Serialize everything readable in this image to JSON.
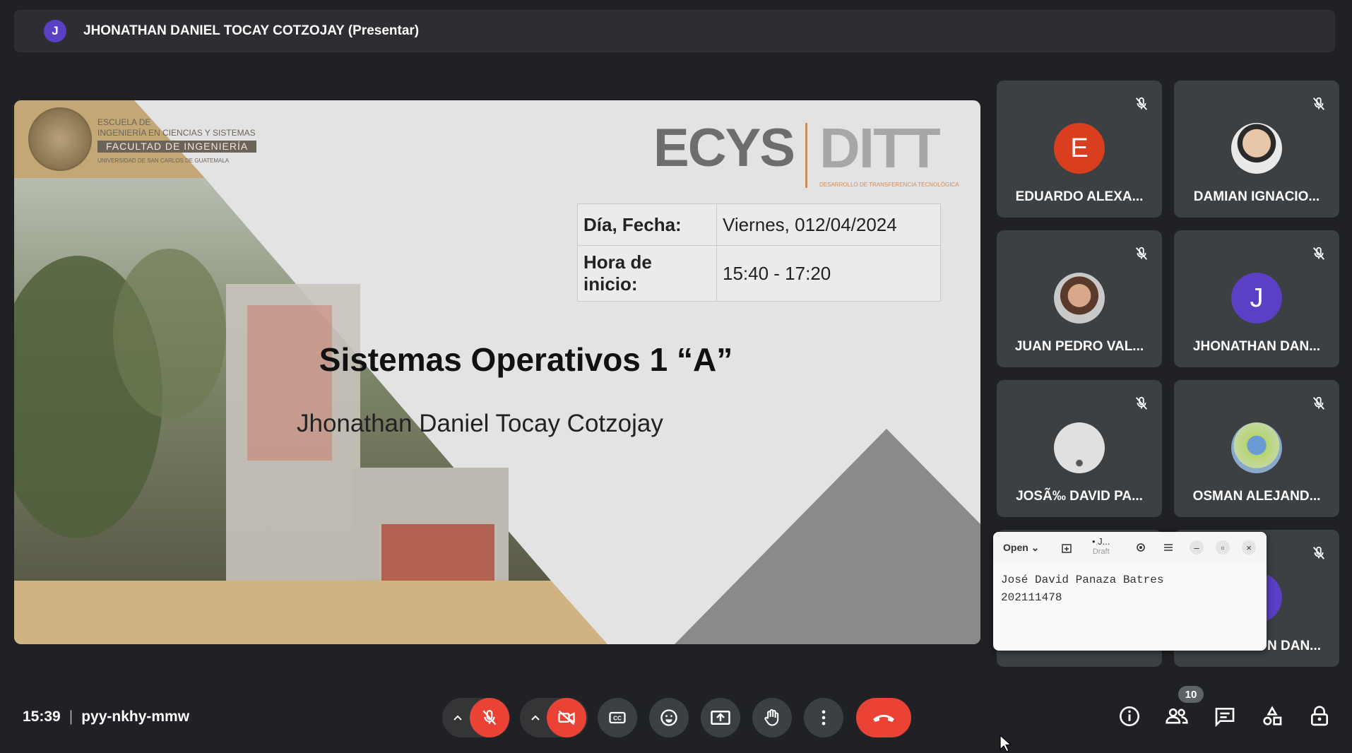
{
  "presenter": {
    "initial": "J",
    "label": "JHONATHAN DANIEL TOCAY COTZOJAY (Presentar)"
  },
  "slide": {
    "school_line1": "ESCUELA DE",
    "school_line2": "INGENIERÍA EN CIENCIAS Y SISTEMAS",
    "faculty": "FACULTAD DE INGENIERÍA",
    "university": "UNIVERSIDAD DE SAN CARLOS DE GUATEMALA",
    "logo_left": "ECYS",
    "logo_right": "DITT",
    "logo_sub": "DESARROLLO DE TRANSFERENCIA TECNOLÓGICA",
    "date_label": "Día, Fecha:",
    "date_value": "Viernes, 012/04/2024",
    "time_label": "Hora de inicio:",
    "time_value": "15:40 - 17:20",
    "title": "Sistemas Operativos 1 “A”",
    "author": "Jhonathan Daniel Tocay Cotzojay"
  },
  "participants": [
    {
      "name": "EDUARDO ALEXA...",
      "initial": "E",
      "color": "#d93f1e",
      "muted": true
    },
    {
      "name": "DAMIAN IGNACIO...",
      "initial": "",
      "color": "#cfcfcf",
      "muted": true
    },
    {
      "name": "JUAN PEDRO VAL...",
      "initial": "",
      "color": "#b78a6a",
      "muted": true
    },
    {
      "name": "JHONATHAN DAN...",
      "initial": "J",
      "color": "#5b3fc4",
      "muted": true
    },
    {
      "name": "JOSÃ‰ DAVID PA...",
      "initial": "",
      "color": "#d8d8d8",
      "muted": true
    },
    {
      "name": "OSMAN ALEJAND...",
      "initial": "",
      "color": "#a9c47a",
      "muted": true
    },
    {
      "name": "",
      "initial": "",
      "color": "#3c4043",
      "muted": false
    },
    {
      "name": "N DAN...",
      "initial": "",
      "color": "#5b3fc4",
      "muted": true
    }
  ],
  "editor": {
    "open_label": "Open",
    "title": "• J...",
    "subtitle": "Draft",
    "line1": "José David Panaza Batres",
    "line2": "202111478"
  },
  "meeting": {
    "time": "15:39",
    "separator": "|",
    "code": "pyy-nkhy-mmw"
  },
  "people_count": "10"
}
